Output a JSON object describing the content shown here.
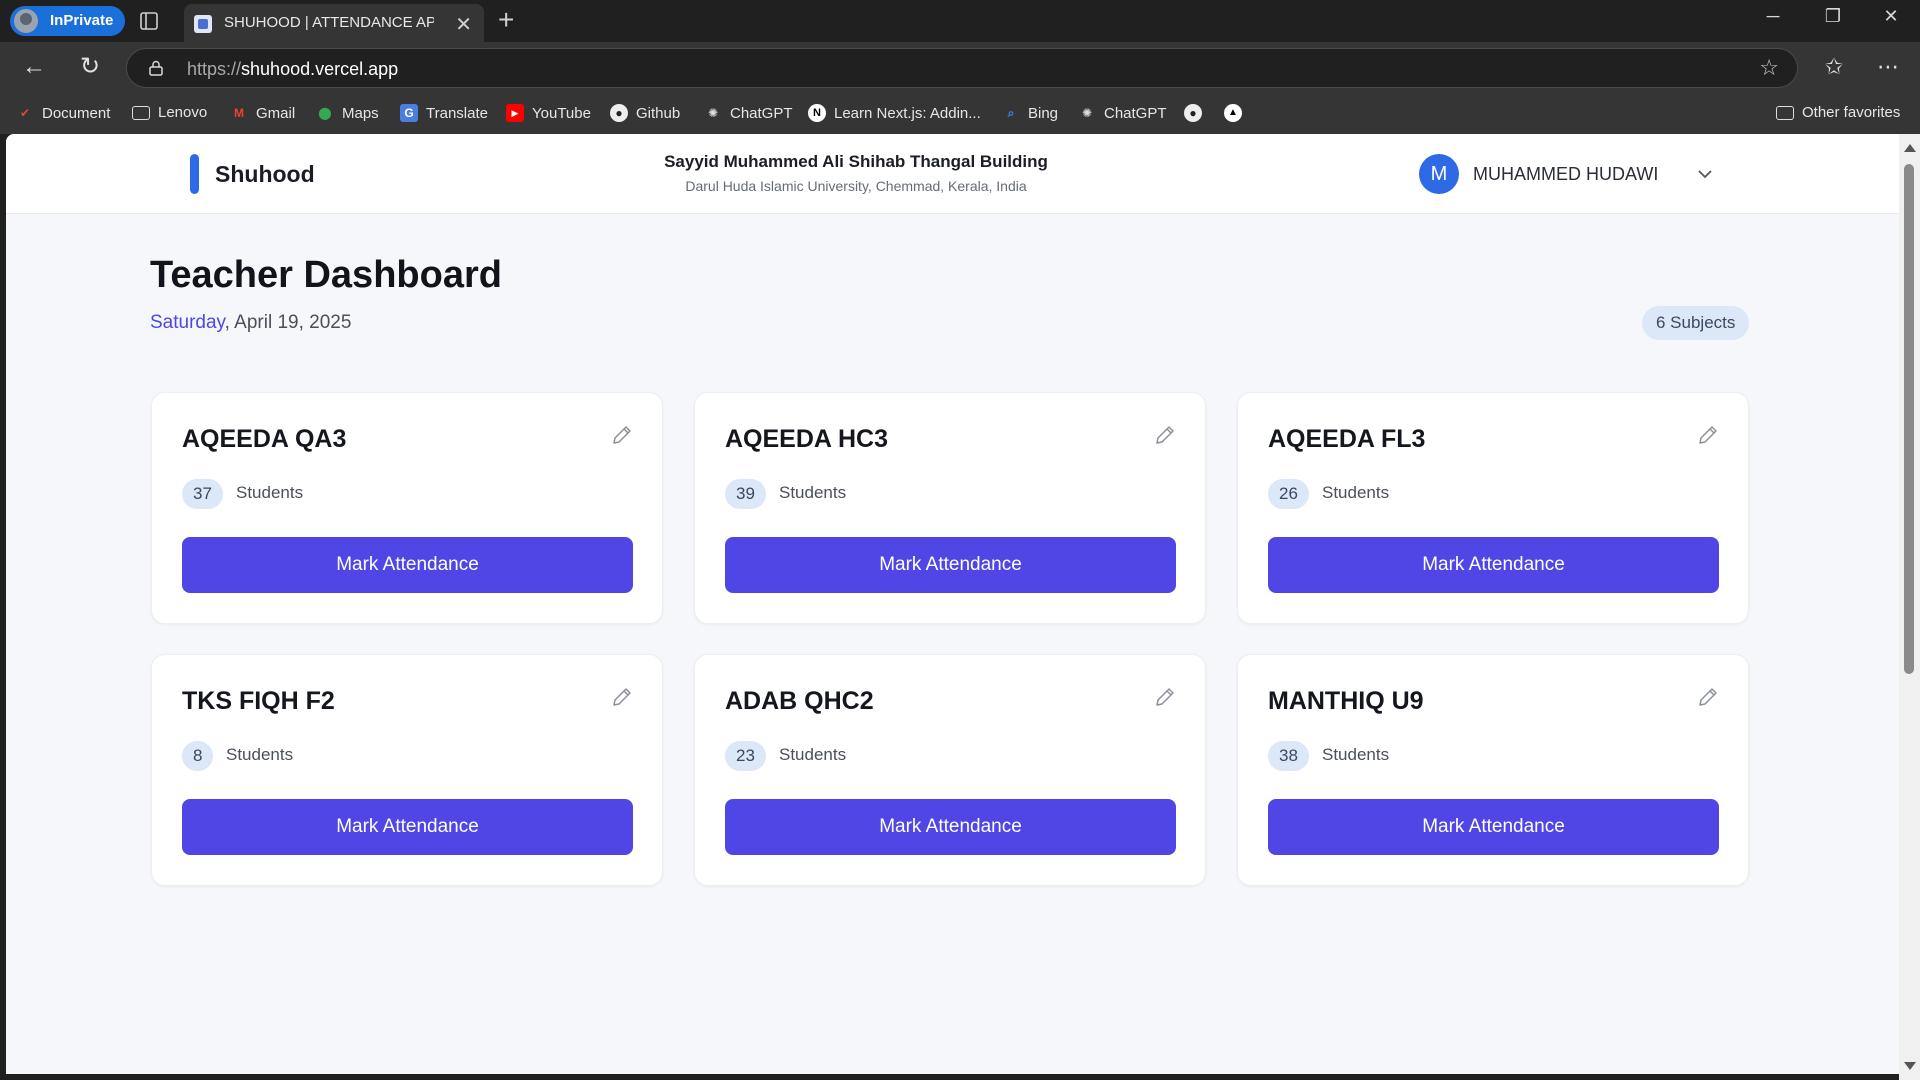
{
  "browser": {
    "inprivate_label": "InPrivate",
    "tab_title": "SHUHOOD | ATTENDANCE APPLIC",
    "url_protocol": "https://",
    "url_host": "shuhood.vercel.app",
    "bookmarks": [
      "Document",
      "Lenovo",
      "Gmail",
      "Maps",
      "Translate",
      "YouTube",
      "Github",
      "ChatGPT",
      "Learn Next.js: Addin...",
      "Bing",
      "ChatGPT"
    ],
    "other_favorites": "Other favorites"
  },
  "header": {
    "brand": "Shuhood",
    "building_name": "Sayyid Muhammed Ali Shihab Thangal Building",
    "building_location": "Darul Huda Islamic University, Chemmad, Kerala, India",
    "avatar_initial": "M",
    "user_name": "MUHAMMED HUDAWI"
  },
  "dashboard": {
    "title": "Teacher Dashboard",
    "weekday": "Saturday",
    "date_rest": ", April 19, 2025",
    "subjects_badge": "6 Subjects"
  },
  "subjects": [
    {
      "name": "AQEEDA QA3",
      "students": "37",
      "students_label": "Students",
      "button": "Mark Attendance"
    },
    {
      "name": "AQEEDA HC3",
      "students": "39",
      "students_label": "Students",
      "button": "Mark Attendance"
    },
    {
      "name": "AQEEDA FL3",
      "students": "26",
      "students_label": "Students",
      "button": "Mark Attendance"
    },
    {
      "name": "TKS FIQH F2",
      "students": "8",
      "students_label": "Students",
      "button": "Mark Attendance"
    },
    {
      "name": "ADAB QHC2",
      "students": "23",
      "students_label": "Students",
      "button": "Mark Attendance"
    },
    {
      "name": "MANTHIQ U9",
      "students": "38",
      "students_label": "Students",
      "button": "Mark Attendance"
    }
  ],
  "colors": {
    "accent": "#4f46e5",
    "brand_blue": "#2f6ae6",
    "badge_bg": "#dce7f7",
    "page_bg": "#f5f7fb"
  }
}
